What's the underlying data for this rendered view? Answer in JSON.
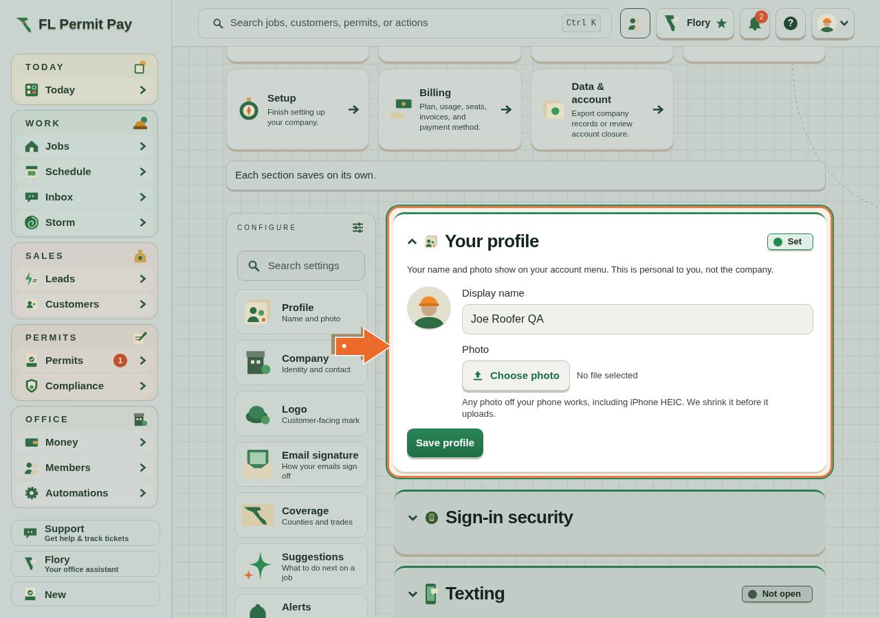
{
  "app": {
    "name": "FL Permit Pay"
  },
  "sidebar": {
    "groups": [
      {
        "label": "TODAY",
        "color": "#d5d6c3",
        "items": [
          {
            "label": "Today"
          }
        ]
      },
      {
        "label": "WORK",
        "color": "#c6d4cc",
        "items": [
          {
            "label": "Jobs"
          },
          {
            "label": "Schedule"
          },
          {
            "label": "Inbox"
          },
          {
            "label": "Storm"
          }
        ]
      },
      {
        "label": "SALES",
        "color": "#d4d0c9",
        "items": [
          {
            "label": "Leads"
          },
          {
            "label": "Customers"
          }
        ]
      },
      {
        "label": "PERMITS",
        "color": "#d4cfc4",
        "items": [
          {
            "label": "Permits",
            "badge": "1"
          },
          {
            "label": "Compliance"
          }
        ]
      },
      {
        "label": "OFFICE",
        "color": "#cdd2cd",
        "items": [
          {
            "label": "Money"
          },
          {
            "label": "Members"
          },
          {
            "label": "Automations"
          }
        ]
      }
    ],
    "footer_items": [
      {
        "title": "Support",
        "subtitle": "Get help & track tickets"
      },
      {
        "title": "Flory",
        "subtitle": "Your office assistant"
      },
      {
        "title": "New"
      }
    ]
  },
  "topbar": {
    "search": {
      "placeholder": "Search jobs, customers, permits, or actions",
      "shortcut": "Ctrl K"
    },
    "assistant": {
      "label": "Flory"
    },
    "notifications": {
      "count": "2"
    },
    "help": "?"
  },
  "shortcut_cards": [
    {
      "title": "Setup",
      "description": "Finish setting up your company."
    },
    {
      "title": "Billing",
      "description": "Plan, usage, seats, invoices, and payment method."
    },
    {
      "title": "Data & account",
      "description": "Export company records or review account closure."
    }
  ],
  "note": "Each section saves on its own.",
  "settings_nav": {
    "heading": "CONFIGURE",
    "search": {
      "placeholder": "Search settings"
    },
    "items": [
      {
        "title": "Profile",
        "subtitle": "Name and photo"
      },
      {
        "title": "Company",
        "subtitle": "Identity and contact"
      },
      {
        "title": "Logo",
        "subtitle": "Customer-facing mark"
      },
      {
        "title": "Email signature",
        "subtitle": "How your emails sign off"
      },
      {
        "title": "Coverage",
        "subtitle": "Counties and trades"
      },
      {
        "title": "Suggestions",
        "subtitle": "What to do next on a job"
      },
      {
        "title": "Alerts"
      }
    ]
  },
  "sections": [
    {
      "title": "Your profile",
      "expanded": true,
      "highlighted": true,
      "status": {
        "label": "Set",
        "color": "#24894f"
      },
      "description": "Your name and photo show on your account menu. This is personal to you, not the company.",
      "display_name": {
        "label": "Display name",
        "value": "Joe Roofer QA"
      },
      "photo": {
        "label": "Photo",
        "button": "Choose photo",
        "file_status": "No file selected",
        "hint": "Any photo off your phone works, including iPhone HEIC. We shrink it before it uploads."
      },
      "save_button": "Save profile"
    },
    {
      "title": "Sign-in security",
      "expanded": false,
      "highlighted": false
    },
    {
      "title": "Texting",
      "expanded": false,
      "highlighted": false,
      "status": {
        "label": "Not open",
        "color": "#3e574a"
      }
    }
  ]
}
